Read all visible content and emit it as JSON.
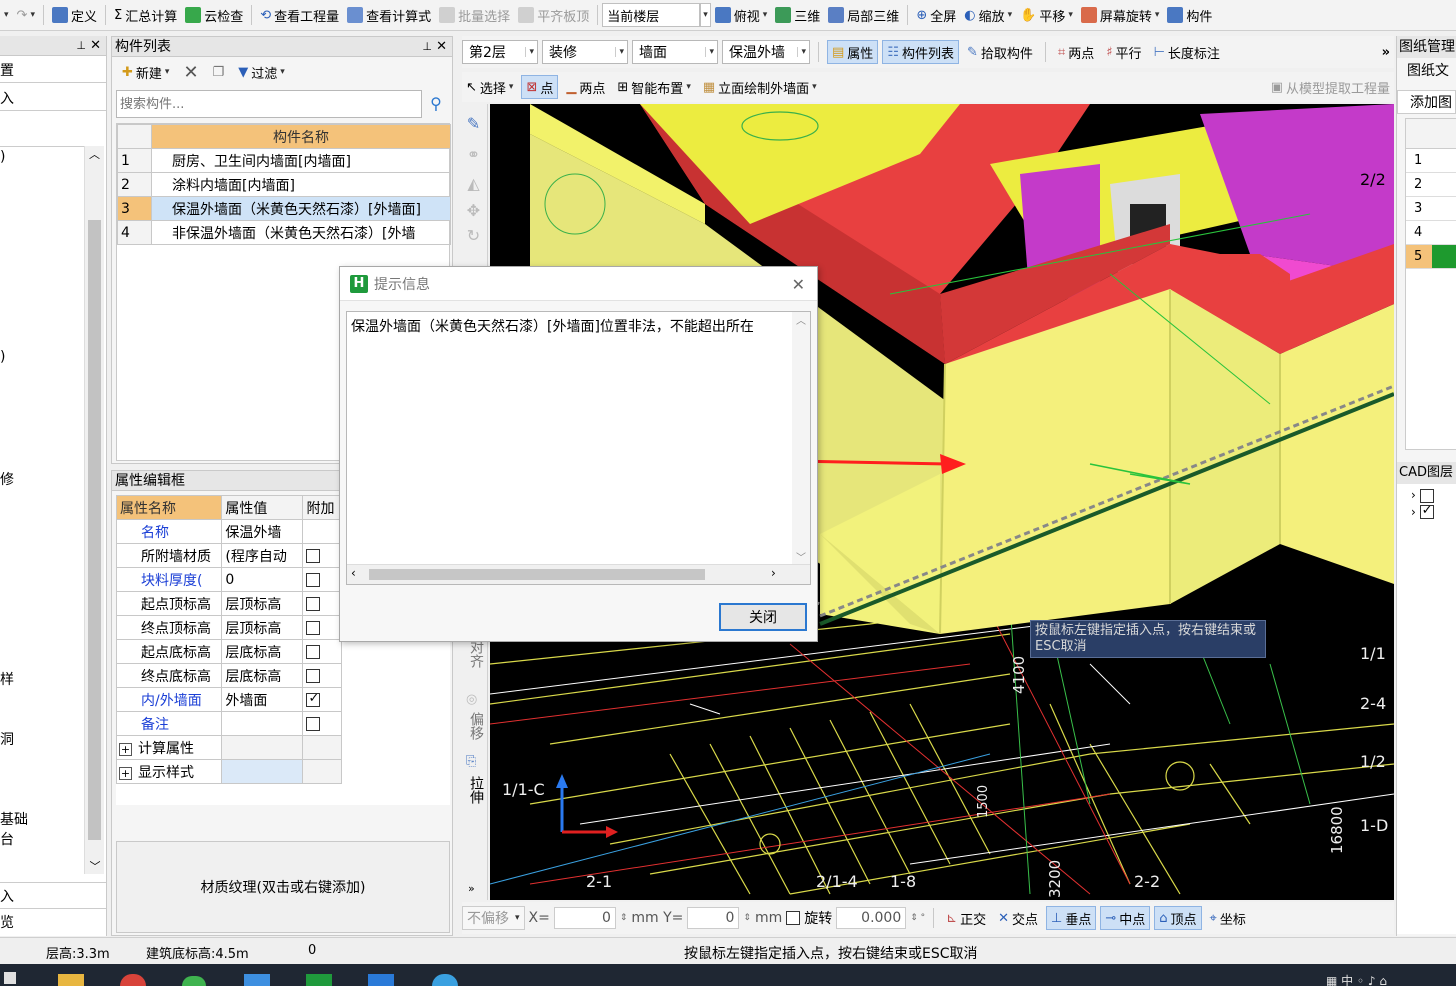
{
  "toolbar": {
    "items": [
      "定义",
      "汇总计算",
      "云检查",
      "查看工程量",
      "查看计算式",
      "批量选择",
      "平齐板顶",
      "当前楼层",
      "俯视",
      "三维",
      "局部三维",
      "全屏",
      "缩放",
      "平移",
      "屏幕旋转",
      "构件"
    ]
  },
  "toolbar2": {
    "floor": "第2层",
    "type": "装修",
    "subtype": "墙面",
    "component": "保温外墙",
    "attr": "属性",
    "list": "构件列表",
    "pick": "拾取构件",
    "two_point": "两点",
    "parallel": "平行",
    "length": "长度标注"
  },
  "toolbar3": {
    "select": "选择",
    "point": "点",
    "two_point": "两点",
    "smart": "智能布置",
    "facade": "立面绘制外墙面",
    "extract": "从模型提取工程量"
  },
  "left_strip": {
    "chars": [
      "置",
      "入",
      ")",
      ")",
      "修",
      "样",
      "洞",
      "基础",
      "台",
      "入",
      "览"
    ]
  },
  "component_list": {
    "title": "构件列表",
    "new": "新建",
    "filter": "过滤",
    "search_placeholder": "搜索构件...",
    "header": "构件名称",
    "rows": [
      {
        "n": "1",
        "name": "厨房、卫生间内墙面[内墙面]"
      },
      {
        "n": "2",
        "name": "涂料内墙面[内墙面]"
      },
      {
        "n": "3",
        "name": "保温外墙面（米黄色天然石漆）[外墙面]"
      },
      {
        "n": "4",
        "name": "非保温外墙面（米黄色天然石漆）[外墙"
      }
    ]
  },
  "props": {
    "title": "属性编辑框",
    "h_name": "属性名称",
    "h_val": "属性值",
    "h_extra": "附加",
    "rows": [
      {
        "name": "名称",
        "val": "保温外墙"
      },
      {
        "name": "所附墙材质",
        "val": "(程序自动"
      },
      {
        "name": "块料厚度(",
        "val": "0"
      },
      {
        "name": "起点顶标高",
        "val": "层顶标高"
      },
      {
        "name": "终点顶标高",
        "val": "层顶标高"
      },
      {
        "name": "起点底标高",
        "val": "层底标高"
      },
      {
        "name": "终点底标高",
        "val": "层底标高"
      },
      {
        "name": "内/外墙面",
        "val": "外墙面"
      },
      {
        "name": "备注",
        "val": ""
      },
      {
        "name": "计算属性",
        "val": ""
      },
      {
        "name": "显示样式",
        "val": ""
      }
    ],
    "material": "材质纹理(双击或右键添加)"
  },
  "dialog": {
    "title": "提示信息",
    "message": "保温外墙面（米黄色天然石漆）[外墙面]位置非法，不能超出所在",
    "close": "关闭"
  },
  "viewport": {
    "tooltip": "按鼠标左键指定插入点，按右键结束或ESC取消",
    "labels": [
      "2-4",
      "2/2",
      "1/1",
      "2-4",
      "1/2",
      "1-D",
      "2-1",
      "2/1-4",
      "1-8",
      "2-2",
      "1/1-C",
      "4100",
      "3200",
      "16800",
      "1500"
    ],
    "side_tools": [
      "对齐",
      "偏移",
      "拉伸"
    ]
  },
  "right_panel": {
    "title": "图纸管理",
    "sub": "图纸文",
    "add": "添加图",
    "rows": [
      "1",
      "2",
      "3",
      "4",
      "5"
    ],
    "cad": "CAD图层"
  },
  "bottom_bar": {
    "no_offset": "不偏移",
    "x_label": "X=",
    "x_val": "0",
    "y_label": "mm Y=",
    "y_val": "0",
    "mm": "mm",
    "rotate": "旋转",
    "rotate_val": "0.000",
    "ortho": "正交",
    "intersect": "交点",
    "perp": "垂点",
    "mid": "中点",
    "vertex": "顶点",
    "coord": "坐标"
  },
  "status": {
    "floor_height": "层高:3.3m",
    "base_elev": "建筑底标高:4.5m",
    "zero": "0",
    "hint": "按鼠标左键指定插入点，按右键结束或ESC取消"
  },
  "colors": {
    "accent_select": "#1c5fc9",
    "wall_yellow": "#ecec7a",
    "wall_red": "#e84040",
    "wall_magenta": "#c43ac9",
    "arrow_red": "#ff1e1e"
  }
}
